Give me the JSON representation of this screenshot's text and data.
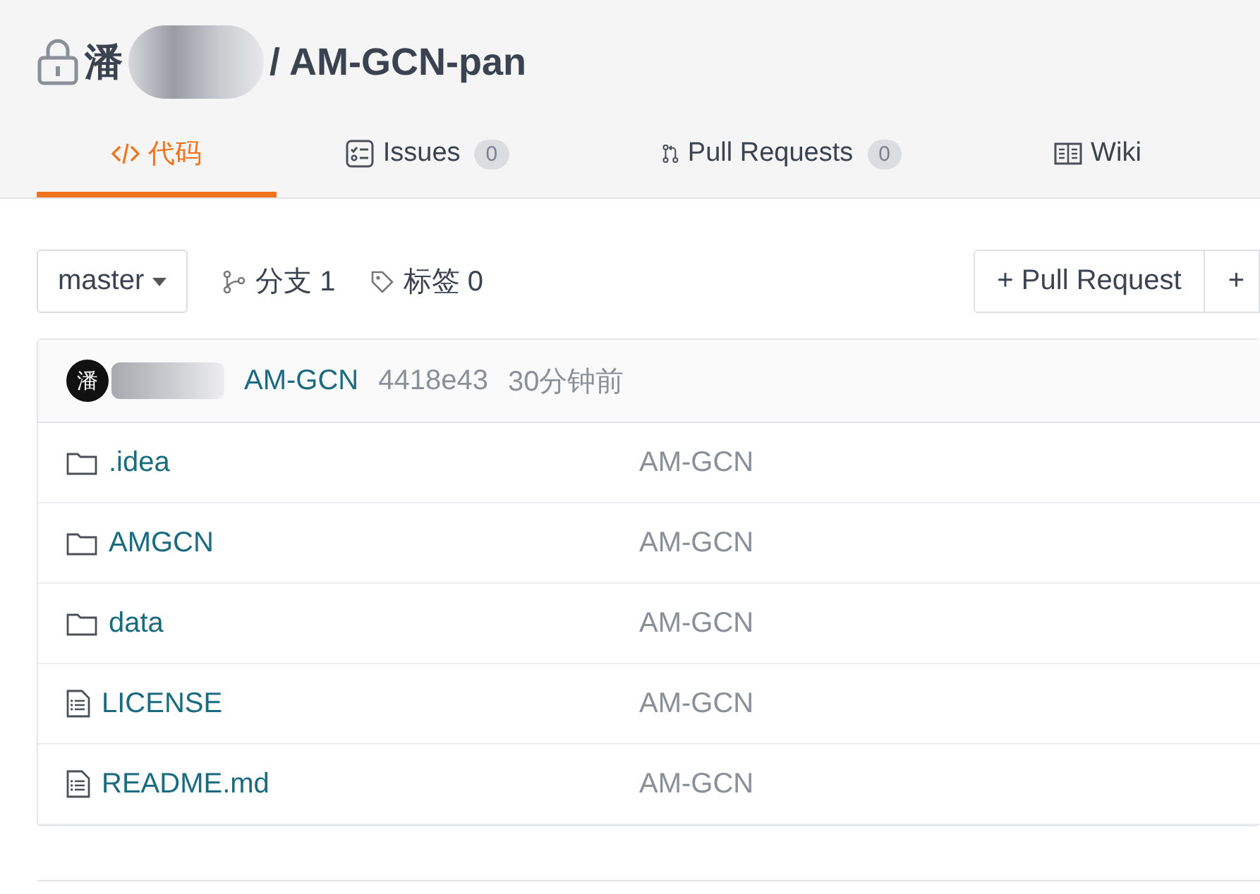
{
  "repo": {
    "owner_visible": "潘",
    "separator_name": "/ AM-GCN-pan",
    "private": true
  },
  "tabs": [
    {
      "label": "代码",
      "kind": "code",
      "selected": true
    },
    {
      "label": "Issues",
      "kind": "issues",
      "count": "0",
      "selected": false
    },
    {
      "label": "Pull Requests",
      "kind": "pulls",
      "count": "0",
      "selected": false
    },
    {
      "label": "Wiki",
      "kind": "wiki",
      "selected": false
    }
  ],
  "toolbar": {
    "branch": "master",
    "branches": "分支 1",
    "tags": "标签 0",
    "buttons": [
      "+ Pull Request",
      "+"
    ]
  },
  "commit": {
    "avatar": "潘",
    "message": "AM-GCN",
    "sha": "4418e43",
    "time": "30分钟前"
  },
  "files": [
    {
      "name": ".idea",
      "kind": "folder",
      "commit": "AM-GCN"
    },
    {
      "name": "AMGCN",
      "kind": "folder",
      "commit": "AM-GCN"
    },
    {
      "name": "data",
      "kind": "folder",
      "commit": "AM-GCN"
    },
    {
      "name": "LICENSE",
      "kind": "file",
      "commit": "AM-GCN"
    },
    {
      "name": "README.md",
      "kind": "file",
      "commit": "AM-GCN"
    }
  ]
}
